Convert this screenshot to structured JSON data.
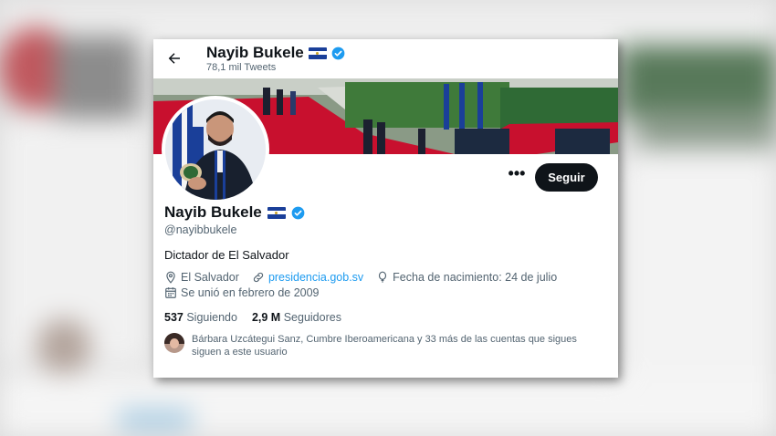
{
  "header": {
    "name": "Nayib Bukele",
    "tweet_count": "78,1 mil Tweets"
  },
  "profile": {
    "name": "Nayib Bukele",
    "handle": "@nayibbukele",
    "bio": "Dictador de El Salvador",
    "location": "El Salvador",
    "website": "presidencia.gob.sv",
    "birthday": "Fecha de nacimiento: 24 de julio",
    "joined": "Se unió en febrero de 2009"
  },
  "actions": {
    "more_label": "•••",
    "follow_label": "Seguir"
  },
  "stats": {
    "following_count": "537",
    "following_label": "Siguiendo",
    "followers_count": "2,9 M",
    "followers_label": "Seguidores"
  },
  "known_followers": {
    "text": "Bárbara Uzcátegui Sanz, Cumbre Iberoamericana y 33 más de las cuentas que sigues siguen a este usuario"
  },
  "icons": {
    "back": "arrow-left-icon",
    "verified": "verified-badge-icon",
    "flag": "el-salvador-flag-icon",
    "location": "location-pin-icon",
    "link": "link-icon",
    "birthday": "balloon-icon",
    "calendar": "calendar-icon"
  },
  "colors": {
    "accent": "#1d9bf0",
    "follow_button": "#0f1419",
    "text_primary": "#0f1419",
    "text_secondary": "#536471",
    "flag_blue": "#1a3f99"
  }
}
